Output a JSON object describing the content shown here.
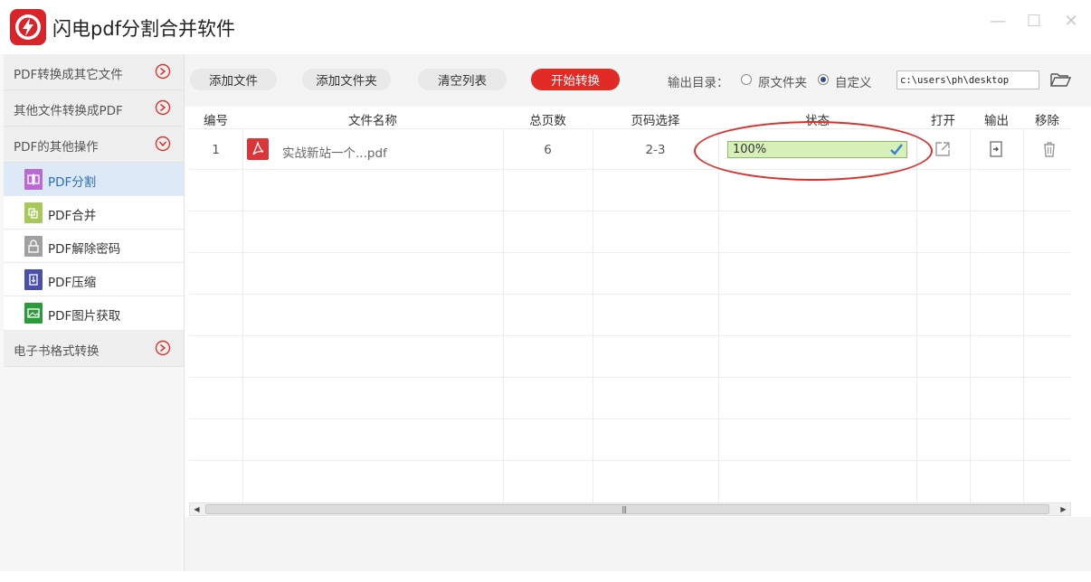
{
  "app": {
    "title": "闪电pdf分割合并软件"
  },
  "window": {
    "minimize": "—",
    "maximize": "☐",
    "close": "✕"
  },
  "sidebar": {
    "categories": [
      {
        "label": "PDF转换成其它文件",
        "state": "collapsed"
      },
      {
        "label": "其他文件转换成PDF",
        "state": "collapsed"
      },
      {
        "label": "PDF的其他操作",
        "state": "expanded"
      },
      {
        "label": "电子书格式转换",
        "state": "collapsed"
      }
    ],
    "items": [
      {
        "label": "PDF分割",
        "icon": "split-icon",
        "color": "#b86ad0",
        "active": true
      },
      {
        "label": "PDF合并",
        "icon": "merge-icon",
        "color": "#a8c85a",
        "active": false
      },
      {
        "label": "PDF解除密码",
        "icon": "unlock-icon",
        "color": "#a0a0a0",
        "active": false
      },
      {
        "label": "PDF压缩",
        "icon": "compress-icon",
        "color": "#4b4fa6",
        "active": false
      },
      {
        "label": "PDF图片获取",
        "icon": "image-extract-icon",
        "color": "#2c9b3c",
        "active": false
      }
    ]
  },
  "toolbar": {
    "add_file": "添加文件",
    "add_folder": "添加文件夹",
    "clear_list": "清空列表",
    "start_convert": "开始转换",
    "output_dir_label": "输出目录：",
    "radio_original": "原文件夹",
    "radio_custom": "自定义",
    "selected_radio": "custom",
    "output_path": "c:\\users\\ph\\desktop"
  },
  "table": {
    "headers": {
      "index": "编号",
      "filename": "文件名称",
      "total_pages": "总页数",
      "page_select": "页码选择",
      "status": "状态",
      "open": "打开",
      "output": "输出",
      "remove": "移除"
    },
    "rows": [
      {
        "index": "1",
        "filename": "实战新站一个...pdf",
        "total_pages": "6",
        "page_select": "2-3",
        "status_text": "100%",
        "progress": 100
      }
    ]
  },
  "colors": {
    "brand_red": "#e02b27",
    "progress_green": "#d6f0b8",
    "active_item_bg": "#dde9f6"
  }
}
